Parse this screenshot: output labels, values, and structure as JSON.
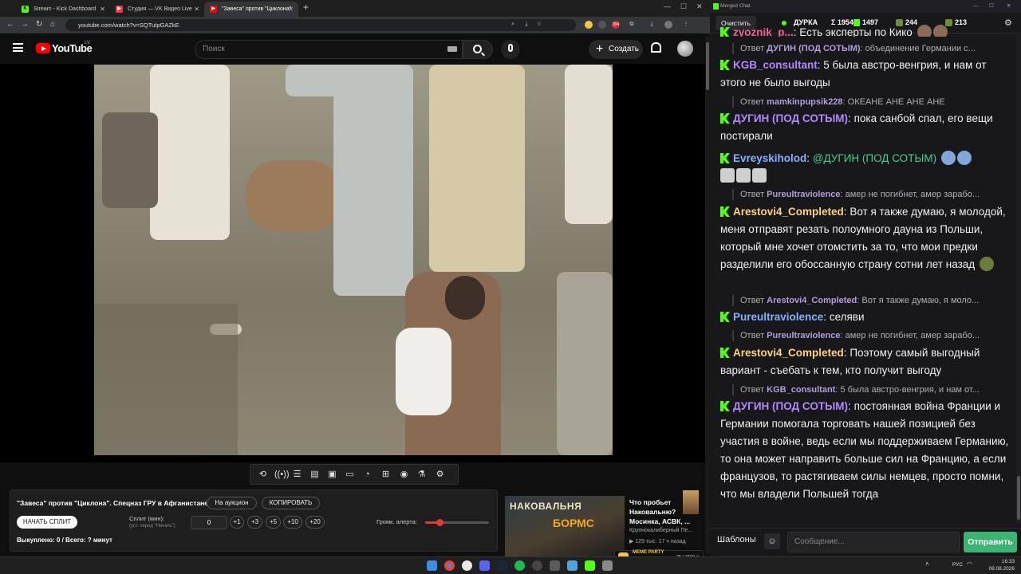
{
  "browser": {
    "tabs": [
      {
        "label": "Stream - Kick Dashboard",
        "icon": "kick-icon",
        "active": false
      },
      {
        "label": "Студия — VK Видео Live",
        "icon": "vk-icon",
        "active": false
      },
      {
        "label": "\"Завеса\" против \"Циклона\"",
        "icon": "youtube-icon",
        "active": true
      }
    ],
    "url": "youtube.com/watch?v=SQTuIpGAZkE",
    "profile_badge": "304"
  },
  "youtube": {
    "logo_text": "YouTube",
    "country": "LV",
    "search_placeholder": "Поиск",
    "create_label": "Создать"
  },
  "panel": {
    "video_title": "\"Завеса\" против \"Циклона\". Спецназ ГРУ в Афганистане.",
    "auction_btn": "На аукцион",
    "copy_btn": "КОПИРОВАТЬ",
    "start_split_btn": "НАЧАТЬ СПЛИТ",
    "split_label": "Сплит (мин):",
    "split_hint": "(уст. перед \"Начать\")",
    "split_value": "0",
    "increments": [
      "+1",
      "+3",
      "+5",
      "+10",
      "+20"
    ],
    "bought_text": "Выкуплено: 0 / Всего: ? минут",
    "volume_label": "Громк. алерта:",
    "volume_level": 0.22
  },
  "recommended": {
    "thumb_text_1": "НАКОВАЛЬНЯ",
    "thumb_text_2": "БОРМС",
    "title": "Что пробьет Наковальню? Мосинка, АСВК, ...",
    "channel": "Крупнокалиберный Пе...",
    "meta": "▶ 129 тыс.  17 ч назад"
  },
  "meme": {
    "label": "MEME PARTY",
    "count": "75 / 1500 ⊙"
  },
  "chat": {
    "window_title": "Merged Chat",
    "clear_btn": "Очистить",
    "channel_name": "ДУРКА",
    "sum": "Σ 1954",
    "kick_count": "1497",
    "count_a": "244",
    "count_b": "213",
    "messages": [
      {
        "type": "msg",
        "user": "zyoznik_p...",
        "user_color": "#f06292",
        "text": "Есть эксперты по Кико"
      },
      {
        "type": "reply",
        "prefix": "Ответ",
        "user": "ДУГИН (ПОД СОТЫМ)",
        "user_color": "#b39ddb",
        "text": "объединение Германии с..."
      },
      {
        "type": "msg",
        "user": "KGB_consultant",
        "user_color": "#b388ff",
        "text": "5 была австро-венгрия, и нам от этого не было выгоды"
      },
      {
        "type": "reply",
        "prefix": "Ответ",
        "user": "mamkinpupsik228",
        "user_color": "#b39ddb",
        "text": "ОКЕАНЕ АНЕ АНЕ АНЕ"
      },
      {
        "type": "msg",
        "user": "ДУГИН (ПОД СОТЫМ)",
        "user_color": "#b388ff",
        "text": "пока санбой спал, его вещи постирали"
      },
      {
        "type": "msg",
        "user": "Evreyskiholod",
        "user_color": "#82b1ff",
        "mention": "@ДУГИН (ПОД СОТЫМ)",
        "text": ""
      },
      {
        "type": "reply",
        "prefix": "Ответ",
        "user": "Pureultraviolence",
        "user_color": "#b39ddb",
        "text": "амер не погибнет, амер зарабо..."
      },
      {
        "type": "msg",
        "user": "Arestovi4_Completed",
        "user_color": "#ffd180",
        "text": "Вот я также думаю, я молодой, меня отправят резать полоумного дауна из Польши, который мне хочет отомстить за то, что мои предки разделили его обоссанную страну сотни лет назад"
      },
      {
        "type": "reply",
        "prefix": "Ответ",
        "user": "Arestovi4_Completed",
        "user_color": "#b39ddb",
        "text": "Вот я также думаю, я моло..."
      },
      {
        "type": "msg",
        "user": "Pureultraviolence",
        "user_color": "#82b1ff",
        "text": "селяви"
      },
      {
        "type": "reply",
        "prefix": "Ответ",
        "user": "Pureultraviolence",
        "user_color": "#b39ddb",
        "text": "амер не погибнет, амер зарабо..."
      },
      {
        "type": "msg",
        "user": "Arestovi4_Completed",
        "user_color": "#ffd180",
        "text": "Поэтому самый выгодный вариант - съебать к тем, кто получит выгоду"
      },
      {
        "type": "reply",
        "prefix": "Ответ",
        "user": "KGB_consultant",
        "user_color": "#b39ddb",
        "text": "5 была австро-венгрия, и нам от..."
      },
      {
        "type": "msg",
        "user": "ДУГИН (ПОД СОТЫМ)",
        "user_color": "#b388ff",
        "text": "постоянная война Франции и Германии помогала торговать нашей позицией без участия в войне, ведь если мы поддерживаем Германию, то она может направить больше сил на Францию, а если французов, то растягиваем силы немцев, просто помни, что мы владели Польшей тогда"
      }
    ],
    "templates_btn": "Шаблоны",
    "input_placeholder": "Сообщение...",
    "send_btn": "Отправить"
  },
  "taskbar": {
    "lang": "РУС",
    "time": "16:33",
    "date": "08.08.2026"
  }
}
